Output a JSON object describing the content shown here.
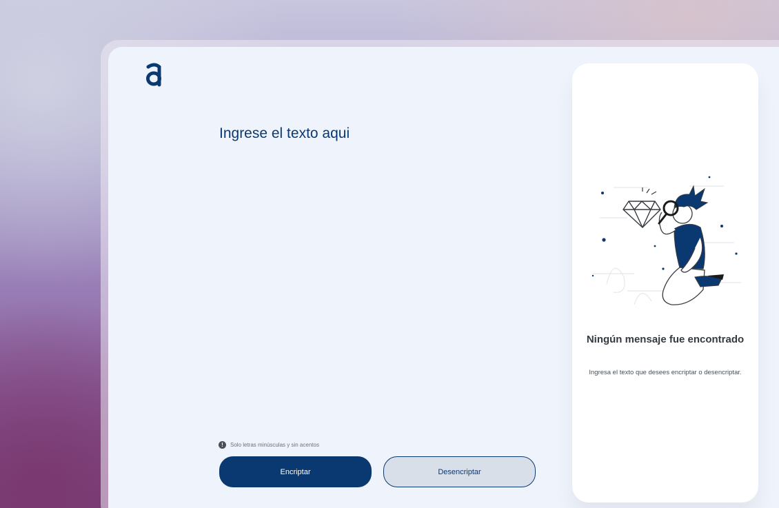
{
  "app": {
    "logo_icon": "alura-a-logo",
    "accent_color": "#0a3871",
    "window_bg": "#eff3fb"
  },
  "input": {
    "placeholder": "Ingrese el texto aqui",
    "value": ""
  },
  "hint": {
    "icon": "info-circle-icon",
    "text": "Solo letras minúsculas y sin acentos"
  },
  "buttons": {
    "encrypt_label": "Encriptar",
    "decrypt_label": "Desencriptar"
  },
  "result": {
    "illustration": "person-with-magnifying-glass-and-diamond",
    "title": "Ningún mensaje fue encontrado",
    "description": "Ingresa el texto que desees encriptar o desencriptar."
  }
}
